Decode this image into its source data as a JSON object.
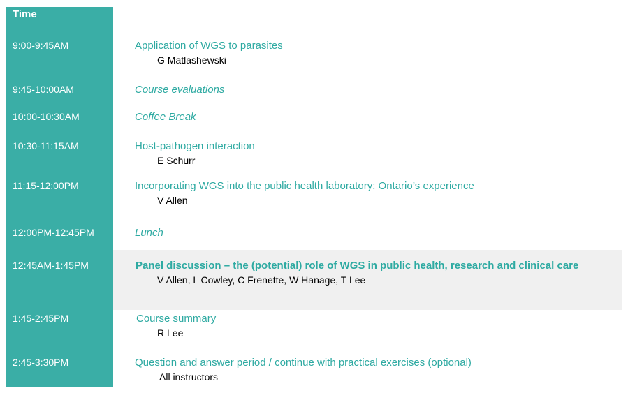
{
  "header": {
    "time_label": "Time"
  },
  "rows": [
    {
      "time": "9:00-9:45AM",
      "title": "Application of WGS to parasites",
      "speaker": "G Matlashewski"
    },
    {
      "time": "9:45-10:00AM",
      "title": "Course evaluations"
    },
    {
      "time": "10:00-10:30AM",
      "title": "Coffee Break"
    },
    {
      "time": "10:30-11:15AM",
      "title": "Host-pathogen interaction",
      "speaker": "E Schurr"
    },
    {
      "time": "11:15-12:00PM",
      "title": "Incorporating WGS into the public health laboratory: Ontario’s experience",
      "speaker": "V Allen"
    },
    {
      "time": "12:00PM-12:45PM",
      "title": "Lunch"
    },
    {
      "time": "12:45AM-1:45PM",
      "title": "Panel discussion – the (potential) role of WGS in public health, research and clinical care",
      "speaker": "V Allen, L Cowley, C Frenette, W Hanage, T Lee"
    },
    {
      "time": "1:45-2:45PM",
      "title": "Course summary",
      "speaker": "R Lee"
    },
    {
      "time": "2:45-3:30PM",
      "title": "Question and answer period / continue with practical exercises (optional)",
      "speaker": "All instructors"
    }
  ],
  "colors": {
    "time_column": "#3aaea6",
    "title_text": "#2eaaa2",
    "highlight_row": "#f0f0f0"
  }
}
